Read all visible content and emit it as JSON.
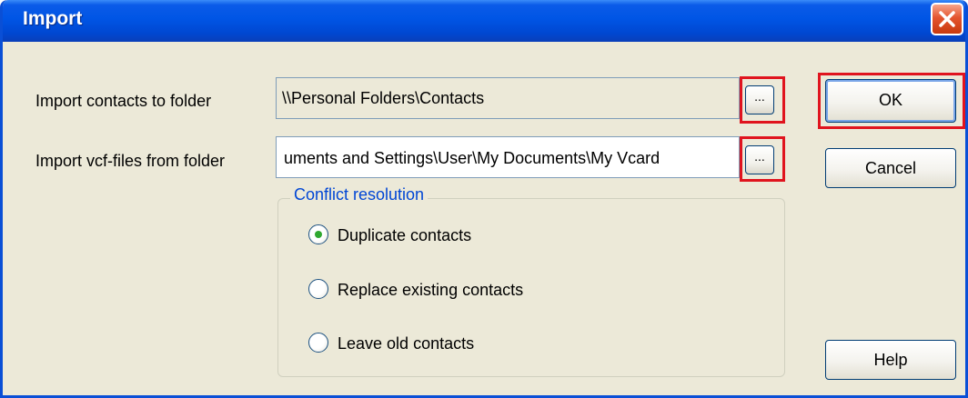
{
  "window": {
    "title": "Import"
  },
  "fields": {
    "contacts_folder": {
      "label": "Import contacts to folder",
      "value": "\\\\Personal Folders\\Contacts",
      "browse_label": "..."
    },
    "vcf_folder": {
      "label": "Import vcf-files from folder",
      "value": "uments and Settings\\User\\My Documents\\My Vcard",
      "browse_label": "..."
    }
  },
  "conflict_resolution": {
    "legend": "Conflict resolution",
    "options": [
      {
        "label": "Duplicate contacts",
        "selected": true
      },
      {
        "label": "Replace existing contacts",
        "selected": false
      },
      {
        "label": "Leave old contacts",
        "selected": false
      }
    ]
  },
  "buttons": {
    "ok": "OK",
    "cancel": "Cancel",
    "help": "Help"
  },
  "colors": {
    "titlebar": "#0055e5",
    "dialog_bg": "#ece9d8",
    "highlight": "#e0141e",
    "legend_text": "#0046d5",
    "radio_selected": "#2fa82f"
  }
}
